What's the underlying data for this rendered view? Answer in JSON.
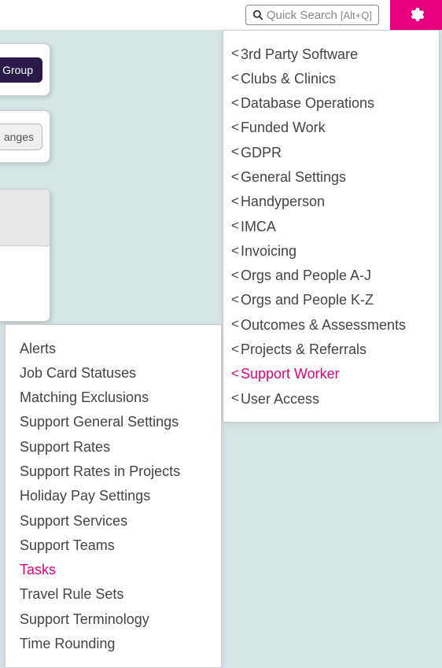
{
  "search": {
    "placeholder": "Quick Search",
    "shortcut": "[Alt+Q]"
  },
  "left_buttons": {
    "group": "Group",
    "anges": "anges"
  },
  "main_menu": [
    {
      "label": "3rd Party Software",
      "active": false
    },
    {
      "label": "Clubs & Clinics",
      "active": false
    },
    {
      "label": "Database Operations",
      "active": false
    },
    {
      "label": "Funded Work",
      "active": false
    },
    {
      "label": "GDPR",
      "active": false
    },
    {
      "label": "General Settings",
      "active": false
    },
    {
      "label": "Handyperson",
      "active": false
    },
    {
      "label": "IMCA",
      "active": false
    },
    {
      "label": "Invoicing",
      "active": false
    },
    {
      "label": "Orgs and People A-J",
      "active": false
    },
    {
      "label": "Orgs and People K-Z",
      "active": false
    },
    {
      "label": "Outcomes & Assessments",
      "active": false
    },
    {
      "label": "Projects & Referrals",
      "active": false
    },
    {
      "label": "Support Worker",
      "active": true
    },
    {
      "label": "User Access",
      "active": false
    }
  ],
  "submenu": [
    {
      "label": "Alerts",
      "active": false
    },
    {
      "label": "Job Card Statuses",
      "active": false
    },
    {
      "label": "Matching Exclusions",
      "active": false
    },
    {
      "label": "Support General Settings",
      "active": false
    },
    {
      "label": "Support Rates",
      "active": false
    },
    {
      "label": "Support Rates in Projects",
      "active": false
    },
    {
      "label": "Holiday Pay Settings",
      "active": false
    },
    {
      "label": "Support Services",
      "active": false
    },
    {
      "label": "Support Teams",
      "active": false
    },
    {
      "label": "Tasks",
      "active": true
    },
    {
      "label": "Travel Rule Sets",
      "active": false
    },
    {
      "label": "Support Terminology",
      "active": false
    },
    {
      "label": "Time Rounding",
      "active": false
    }
  ]
}
